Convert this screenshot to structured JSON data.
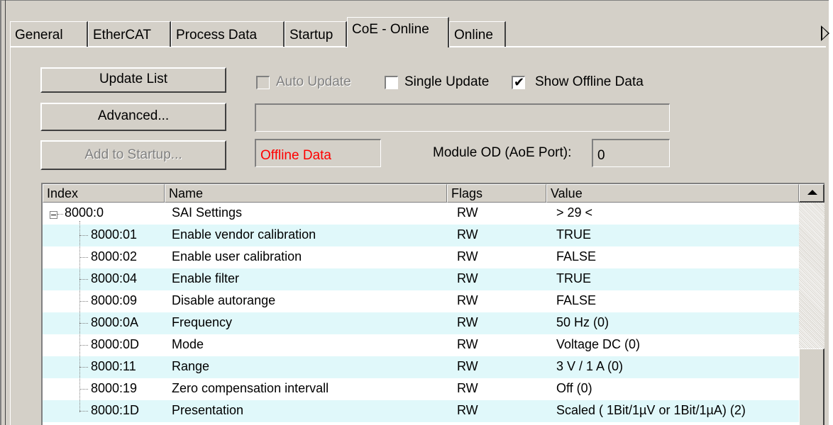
{
  "tabs": [
    "General",
    "EtherCAT",
    "Process Data",
    "Startup",
    "CoE - Online",
    "Online"
  ],
  "active_tab": "CoE - Online",
  "buttons": {
    "update_list": "Update List",
    "advanced": "Advanced...",
    "add_to_startup": "Add to Startup..."
  },
  "options": {
    "auto_update": {
      "label": "Auto Update",
      "checked": false,
      "enabled": false
    },
    "single_update": {
      "label": "Single Update",
      "checked": false,
      "enabled": true
    },
    "show_offline_data": {
      "label": "Show Offline Data",
      "checked": true,
      "enabled": true
    }
  },
  "status_field": "",
  "offline_label": "Offline Data",
  "module_od": {
    "label": "Module OD (AoE Port):",
    "value": "0"
  },
  "columns": [
    "Index",
    "Name",
    "Flags",
    "Value"
  ],
  "rows": [
    {
      "index": "8000:0",
      "name": "SAI Settings",
      "flags": "RW",
      "value": "> 29 <",
      "expandable": true
    },
    {
      "index": "8000:01",
      "name": "Enable vendor calibration",
      "flags": "RW",
      "value": "TRUE"
    },
    {
      "index": "8000:02",
      "name": "Enable user calibration",
      "flags": "RW",
      "value": "FALSE"
    },
    {
      "index": "8000:04",
      "name": "Enable filter",
      "flags": "RW",
      "value": "TRUE"
    },
    {
      "index": "8000:09",
      "name": "Disable autorange",
      "flags": "RW",
      "value": "FALSE"
    },
    {
      "index": "8000:0A",
      "name": "Frequency",
      "flags": "RW",
      "value": "50 Hz (0)"
    },
    {
      "index": "8000:0D",
      "name": "Mode",
      "flags": "RW",
      "value": "Voltage DC (0)"
    },
    {
      "index": "8000:11",
      "name": "Range",
      "flags": "RW",
      "value": "3 V / 1 A (0)"
    },
    {
      "index": "8000:19",
      "name": "Zero compensation intervall",
      "flags": "RW",
      "value": "Off (0)"
    },
    {
      "index": "8000:1D",
      "name": "Presentation",
      "flags": "RW",
      "value": "Scaled ( 1Bit/1µV or 1Bit/1µA) (2)"
    }
  ],
  "colors": {
    "panel": "#d4d0c8",
    "row_alt": "#e0f8fa",
    "offline_text": "#ff0000"
  }
}
